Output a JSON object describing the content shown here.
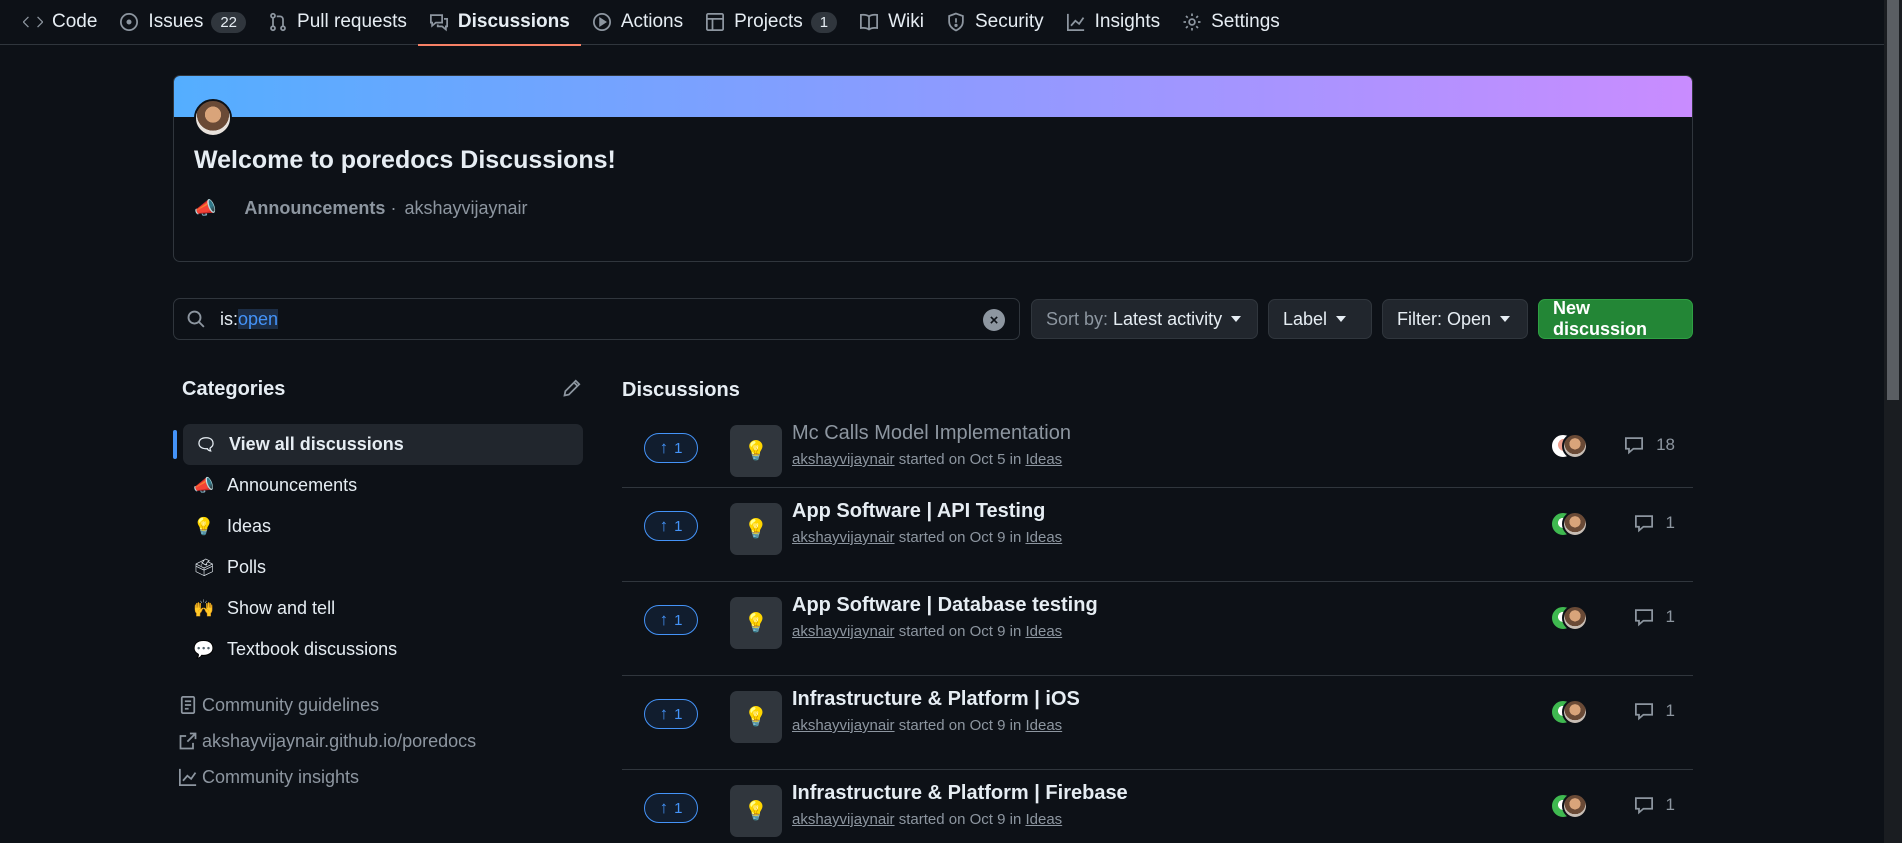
{
  "nav": {
    "tabs": [
      {
        "label": "Code",
        "icon": "code-icon"
      },
      {
        "label": "Issues",
        "count": "22",
        "icon": "issue-opened-icon"
      },
      {
        "label": "Pull requests",
        "icon": "git-pull-request-icon"
      },
      {
        "label": "Discussions",
        "icon": "comment-discussion-icon",
        "active": true
      },
      {
        "label": "Actions",
        "icon": "play-icon"
      },
      {
        "label": "Projects",
        "count": "1",
        "icon": "table-icon"
      },
      {
        "label": "Wiki",
        "icon": "book-icon"
      },
      {
        "label": "Security",
        "icon": "shield-icon"
      },
      {
        "label": "Insights",
        "icon": "graph-icon"
      },
      {
        "label": "Settings",
        "icon": "gear-icon"
      }
    ]
  },
  "pinned": {
    "title": "Welcome to poredocs Discussions!",
    "category_emoji": "📣",
    "category": "Announcements",
    "separator": "·",
    "author": "akshayvijaynair",
    "colors": {
      "gradient_start": "#54aeff",
      "gradient_end": "#c98cff"
    }
  },
  "toolbar": {
    "search_prefix": "is:",
    "search_highlight": "open",
    "sort_label": "Sort by:",
    "sort_value": "Latest activity",
    "label_button": "Label",
    "filter_button": "Filter: Open",
    "new_button": "New discussion"
  },
  "sidebar": {
    "heading": "Categories",
    "categories": [
      {
        "label": "View all discussions",
        "emoji": "🗨",
        "active": true
      },
      {
        "label": "Announcements",
        "emoji": "📣"
      },
      {
        "label": "Ideas",
        "emoji": "💡"
      },
      {
        "label": "Polls",
        "emoji": "🗳"
      },
      {
        "label": "Show and tell",
        "emoji": "🙌"
      },
      {
        "label": "Textbook discussions",
        "emoji": "💬"
      }
    ],
    "links": [
      {
        "label": "Community guidelines",
        "icon": "law-icon"
      },
      {
        "label": "akshayvijaynair.github.io/poredocs",
        "icon": "link-external-icon"
      },
      {
        "label": "Community insights",
        "icon": "graph-icon"
      }
    ]
  },
  "discussions": {
    "heading": "Discussions",
    "items": [
      {
        "votes": "1",
        "title": "Mc Calls Model Implementation",
        "author": "akshayvijaynair",
        "started": "started on Oct 5 in",
        "category": "Ideas",
        "comments": "18",
        "read": true,
        "emoji": "💡"
      },
      {
        "votes": "1",
        "title": "App Software | API Testing",
        "author": "akshayvijaynair",
        "started": "started on Oct 9 in",
        "category": "Ideas",
        "comments": "1",
        "read": false,
        "emoji": "💡"
      },
      {
        "votes": "1",
        "title": "App Software | Database testing",
        "author": "akshayvijaynair",
        "started": "started on Oct 9 in",
        "category": "Ideas",
        "comments": "1",
        "read": false,
        "emoji": "💡"
      },
      {
        "votes": "1",
        "title": "Infrastructure & Platform | iOS",
        "author": "akshayvijaynair",
        "started": "started on Oct 9 in",
        "category": "Ideas",
        "comments": "1",
        "read": false,
        "emoji": "💡"
      },
      {
        "votes": "1",
        "title": "Infrastructure & Platform | Firebase",
        "author": "akshayvijaynair",
        "started": "started on Oct 9 in",
        "category": "Ideas",
        "comments": "1",
        "read": false,
        "emoji": "💡"
      }
    ]
  },
  "colors": {
    "accent": "#f78166",
    "link": "#4493f8",
    "primary_button": "#238636",
    "background": "#0d1117"
  }
}
